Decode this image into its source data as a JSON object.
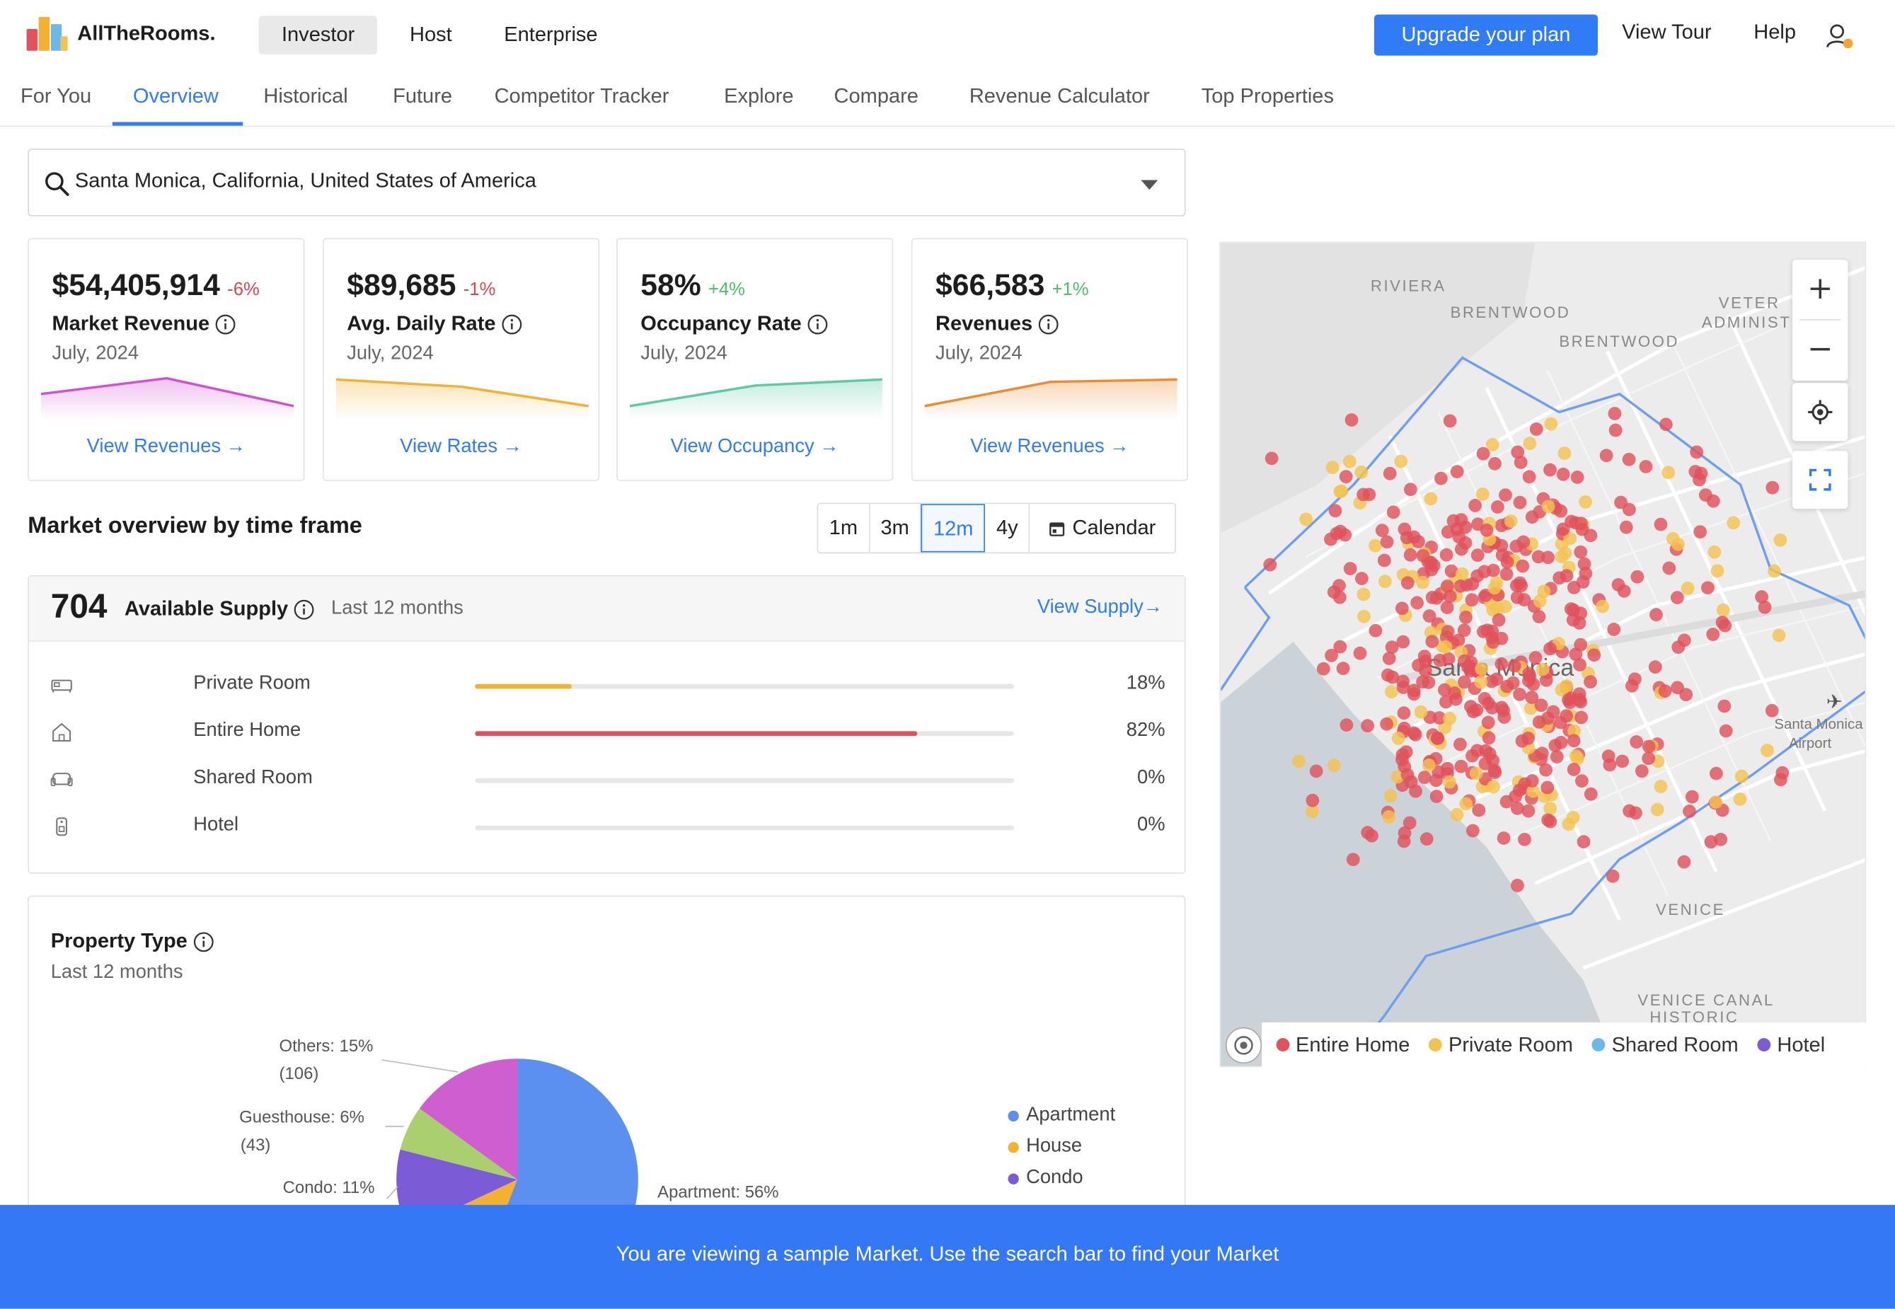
{
  "brand": {
    "name": "AllTheRooms."
  },
  "header": {
    "personas": [
      "Investor",
      "Host",
      "Enterprise"
    ],
    "upgrade_label": "Upgrade your plan",
    "tour_label": "View Tour",
    "help_label": "Help"
  },
  "tabs": [
    "For You",
    "Overview",
    "Historical",
    "Future",
    "Competitor Tracker",
    "Explore",
    "Compare",
    "Revenue Calculator",
    "Top Properties"
  ],
  "active_tab": "Overview",
  "search": {
    "value": "Santa Monica, California, United States of America"
  },
  "kpis": [
    {
      "value": "$54,405,914",
      "delta": "-6%",
      "label": "Market Revenue",
      "date": "July, 2024",
      "link": "View Revenues →",
      "color": "#d14fd1",
      "delta_color": "#e0454f"
    },
    {
      "value": "$89,685",
      "delta": "-1%",
      "label": "Avg. Daily Rate",
      "date": "July, 2024",
      "link": "View Rates →",
      "color": "#f4b12f",
      "delta_color": "#e0454f"
    },
    {
      "value": "58%",
      "delta": "+4%",
      "label": "Occupancy Rate",
      "date": "July, 2024",
      "link": "View Occupancy →",
      "color": "#5cc9a7",
      "delta_color": "#4cbf6b"
    },
    {
      "value": "$66,583",
      "delta": "+1%",
      "label": "Revenues",
      "date": "July, 2024",
      "link": "View Revenues →",
      "color": "#ef8a2f",
      "delta_color": "#4cbf6b"
    }
  ],
  "timeframe": {
    "title": "Market overview by time frame",
    "options": [
      "1m",
      "3m",
      "12m",
      "4y"
    ],
    "selected": "12m",
    "calendar_label": "Calendar"
  },
  "supply": {
    "count": "704",
    "title": "Available Supply",
    "period": "Last 12 months",
    "link": "View Supply→",
    "rows": [
      {
        "label": "Private Room",
        "pct": "18%",
        "value": 0.18,
        "color": "#f4b12f",
        "icon": "bed-icon"
      },
      {
        "label": "Entire Home",
        "pct": "82%",
        "value": 0.82,
        "color": "#e0525c",
        "icon": "home-icon"
      },
      {
        "label": "Shared Room",
        "pct": "0%",
        "value": 0,
        "color": "#6ab9e8",
        "icon": "sofa-icon"
      },
      {
        "label": "Hotel",
        "pct": "0%",
        "value": 0,
        "color": "#7b5bd6",
        "icon": "hotel-tag-icon"
      }
    ]
  },
  "property_type": {
    "title": "Property Type",
    "subtitle": "Last 12 months",
    "labels": {
      "others": "Others: 15%",
      "others_count": "(106)",
      "guesthouse": "Guesthouse: 6%",
      "guesthouse_count": "(43)",
      "condo": "Condo: 11%",
      "apartment": "Apartment: 56%"
    },
    "legend": [
      "Apartment",
      "House",
      "Condo"
    ],
    "chart_data": {
      "type": "pie",
      "categories": [
        "Apartment",
        "House",
        "Condo",
        "Guesthouse",
        "Others"
      ],
      "values": [
        56,
        12,
        11,
        6,
        15
      ],
      "colors": [
        "#5b8ff0",
        "#f4b12f",
        "#7b5bd6",
        "#a9cf6e",
        "#cf5fd0"
      ]
    }
  },
  "map": {
    "labels": {
      "riviera": "RIVIERA",
      "brentwood1": "BRENTWOOD",
      "brentwood2": "BRENTWOOD",
      "veteran": "VETER",
      "admin": "ADMINIST",
      "city": "Santa Monica",
      "airport": "Santa Monica\nAirport",
      "venice": "VENICE",
      "venice_canal": "VENICE CANAL",
      "historic": "HISTORIC"
    },
    "legend": [
      {
        "label": "Entire Home",
        "color": "#e0525c"
      },
      {
        "label": "Private Room",
        "color": "#f4c24f"
      },
      {
        "label": "Shared Room",
        "color": "#6ab9e8"
      },
      {
        "label": "Hotel",
        "color": "#7b5bd6"
      }
    ]
  },
  "banner": {
    "text": "You are viewing a sample Market. Use the search bar to find your Market"
  }
}
